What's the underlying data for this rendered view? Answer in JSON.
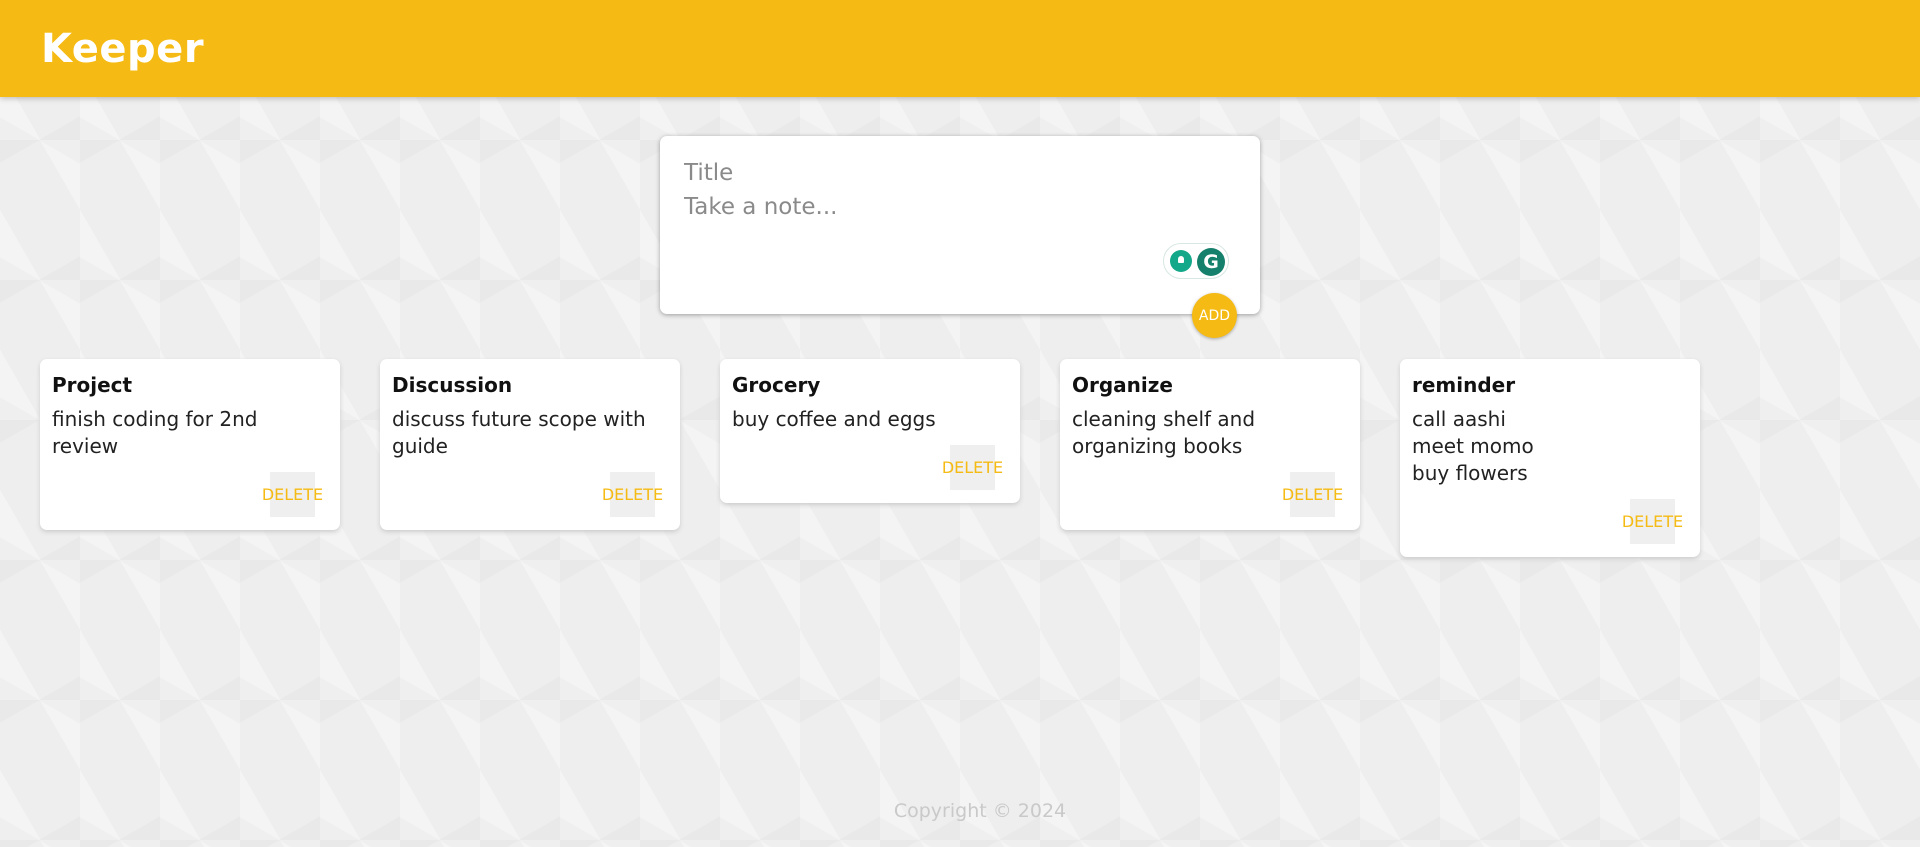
{
  "header": {
    "logo": "Keeper",
    "color": "#f5ba13"
  },
  "create_note": {
    "title_placeholder": "Title",
    "content_placeholder": "Take a note...",
    "add_label": "ADD",
    "widget": {
      "bulb_icon": "lightbulb-icon",
      "g_icon": "G"
    }
  },
  "notes": [
    {
      "title": "Project",
      "content": "finish coding for 2nd review",
      "delete_label": "DELETE"
    },
    {
      "title": "Discussion",
      "content": "discuss future scope with guide",
      "delete_label": "DELETE"
    },
    {
      "title": "Grocery",
      "content": "buy coffee and eggs",
      "delete_label": "DELETE"
    },
    {
      "title": "Organize",
      "content": "cleaning shelf and organizing books",
      "delete_label": "DELETE"
    },
    {
      "title": "reminder",
      "content": "call aashi\nmeet momo\nbuy flowers",
      "delete_label": "DELETE"
    }
  ],
  "footer": {
    "text": "Copyright © 2024"
  }
}
